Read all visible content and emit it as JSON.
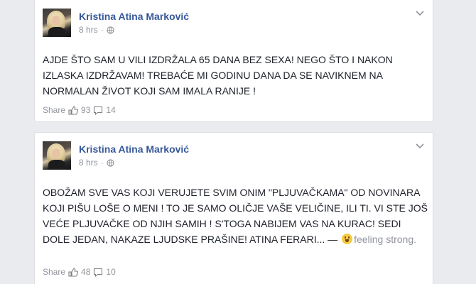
{
  "posts": [
    {
      "author": "Kristina Atina Marković",
      "time": "8 hrs",
      "separator": "·",
      "text": "AJDE ŠTO SAM U VILI IZDRŽALA 65 DANA BEZ SEXA! NEGO ŠTO I NAKON IZLASKA IZDRŽAVAM! TREBAĆE MI GODINU DANA DA SE NAVIKNEM NA NORMALAN ŽIVOT KOJI SAM IMALA RANIJE !",
      "share_label": "Share",
      "likes": "93",
      "comments": "14"
    },
    {
      "author": "Kristina Atina Marković",
      "time": "8 hrs",
      "separator": "·",
      "text": "OBOŽAM SVE VAS KOJI VERUJETE SVIM ONIM \"PLJUVAČKAMA\" OD NOVINARA KOJI PIŠU LOŠE O MENI ! TO JE SAMO OLIČJE VAŠE VELIČINE, ILI TI. VI STE JOŠ VEĆE PLJUVAČKE OD NJIH SAMIH ! S'TOGA NABIJEM VAS NA KURAC! SEDI DOLE JEDAN, NAKAZE LJUDSKE PRAŠINE! ATINA FERARI... —",
      "feeling": "feeling strong.",
      "share_label": "Share",
      "likes": "48",
      "comments": "10"
    }
  ],
  "colors": {
    "page_bg": "#e9ebee",
    "author": "#365899",
    "meta": "#90949c",
    "body_text": "#1d2129",
    "icon": "#7f7f7f"
  },
  "icons": [
    "globe-icon",
    "chevron-down-icon",
    "like-icon",
    "comment-icon",
    "feeling-emoji-icon"
  ]
}
